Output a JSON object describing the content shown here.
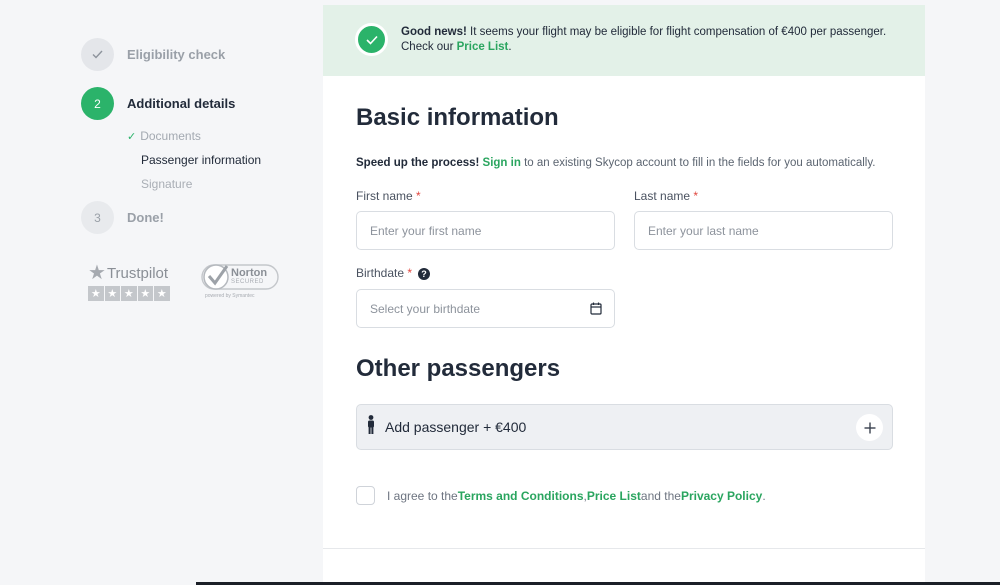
{
  "sidebar": {
    "steps": [
      {
        "number": "✓",
        "label": "Eligibility check",
        "state": "done"
      },
      {
        "number": "2",
        "label": "Additional details",
        "state": "active"
      },
      {
        "number": "3",
        "label": "Done!",
        "state": "pending"
      }
    ],
    "substeps": [
      {
        "label": "Documents",
        "state": "done"
      },
      {
        "label": "Passenger information",
        "state": "current"
      },
      {
        "label": "Signature",
        "state": "pending"
      }
    ],
    "trustpilot": {
      "name": "Trustpilot"
    },
    "norton": {
      "name": "Norton",
      "sub": "SECURED",
      "powered": "powered by Symantec"
    }
  },
  "banner": {
    "strong": "Good news!",
    "text": " It seems your flight may be eligible for flight compensation of €400 per passenger.",
    "line2_prefix": "Check our ",
    "link": "Price List",
    "suffix": "."
  },
  "basic": {
    "title": "Basic information",
    "speed_strong": "Speed up the process!",
    "speed_link": "Sign in",
    "speed_text": " to an existing Skycop account to fill in the fields for you automatically.",
    "first_name_label": "First name",
    "first_name_placeholder": "Enter your first name",
    "last_name_label": "Last name",
    "last_name_placeholder": "Enter your last name",
    "birthdate_label": "Birthdate",
    "birthdate_placeholder": "Select your birthdate",
    "required_mark": "*"
  },
  "other": {
    "title": "Other passengers",
    "add_label": "Add passenger + €400"
  },
  "agree": {
    "prefix": "I agree to the ",
    "terms": "Terms and Conditions",
    "sep1": ", ",
    "price": "Price List",
    "sep2": " and the ",
    "privacy": "Privacy Policy",
    "end": "."
  },
  "colors": {
    "accent": "#2bb36a",
    "banner_bg": "#e3f1e8",
    "text": "#222b3a"
  }
}
